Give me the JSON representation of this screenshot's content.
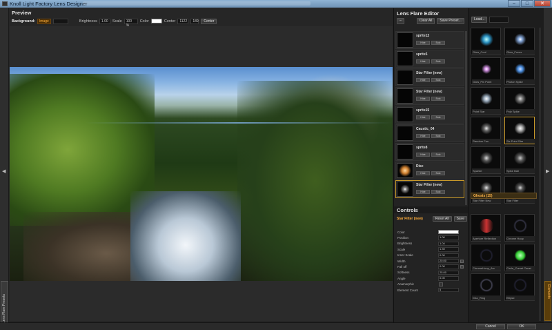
{
  "window": {
    "title": "Knoll Light Factory Lens Designer",
    "min": "–",
    "max": "□",
    "close": "✕"
  },
  "preview": {
    "title": "Preview",
    "background_label": "Background:",
    "background_value": "Image",
    "brightness_label": "Brightness",
    "brightness_value": "1.00",
    "scale_label": "Scale",
    "scale_value": "100 %",
    "color_label": "Color",
    "center_label": "Center",
    "center_x": "1122",
    "center_y": "189",
    "center_button": "Center"
  },
  "left_tab": {
    "label": "Lens Flare Presets",
    "arrow": "◀"
  },
  "editor": {
    "title": "Lens Flare Editor",
    "minus": "–",
    "clear_all": "Clear All",
    "save_preset": "Save Preset...",
    "hide": "Hide",
    "solo": "Solo",
    "layers": [
      {
        "name": "sprite12"
      },
      {
        "name": "sprite5"
      },
      {
        "name": "Star Filter (new)"
      },
      {
        "name": "Star Filter (new)"
      },
      {
        "name": "sprite15"
      },
      {
        "name": "Caustic_04"
      },
      {
        "name": "sprite8"
      },
      {
        "name": "Disc"
      },
      {
        "name": "Star Filter (new)"
      }
    ]
  },
  "controls": {
    "title": "Controls",
    "selected": "Star Filter (new)",
    "reset_all": "Reset All",
    "save": "Save",
    "props": [
      {
        "label": "Color",
        "value": ""
      },
      {
        "label": "Position",
        "value": "1.00"
      },
      {
        "label": "Brightness",
        "value": "1.04"
      },
      {
        "label": "Scale",
        "value": "1.39"
      },
      {
        "label": "Inner Scale",
        "value": "0.00"
      },
      {
        "label": "Width",
        "value": "20.00"
      },
      {
        "label": "Fall off",
        "value": "0.00"
      },
      {
        "label": "Softness",
        "value": "25.00"
      },
      {
        "label": "Angle",
        "value": "0.00"
      },
      {
        "label": "Anamorphic",
        "value": ""
      },
      {
        "label": "Element Count",
        "value": "5"
      }
    ]
  },
  "library": {
    "load": "Load...",
    "ghosts_header": "Ghosts (15)",
    "cells": [
      {
        "caption": "Glow_Cool"
      },
      {
        "caption": "Glow_Focus"
      },
      {
        "caption": "Glow_Pin Point"
      },
      {
        "caption": "Photon Spike"
      },
      {
        "caption": "Point Star"
      },
      {
        "caption": "Poly Spike"
      },
      {
        "caption": "Random Fan"
      },
      {
        "caption": "Six Point Star"
      },
      {
        "caption": "Sparkle"
      },
      {
        "caption": "Spike Ball"
      },
      {
        "caption": "Star Filter New"
      },
      {
        "caption": "Star Filter"
      },
      {
        "caption": "Aperture Reflection"
      },
      {
        "caption": "Chrome Hoop"
      },
      {
        "caption": "ChromeHoop_Arc"
      },
      {
        "caption": "Circle_Comet Caust"
      },
      {
        "caption": "Disc_Ring"
      },
      {
        "caption": "Ellipse"
      },
      {
        "caption": "Ellipse_Narrow"
      },
      {
        "caption": "Ellipse_Quad"
      }
    ]
  },
  "right_tab": {
    "label": "Elements",
    "arrow": "▶"
  },
  "footer": {
    "cancel": "Cancel",
    "ok": "OK"
  }
}
